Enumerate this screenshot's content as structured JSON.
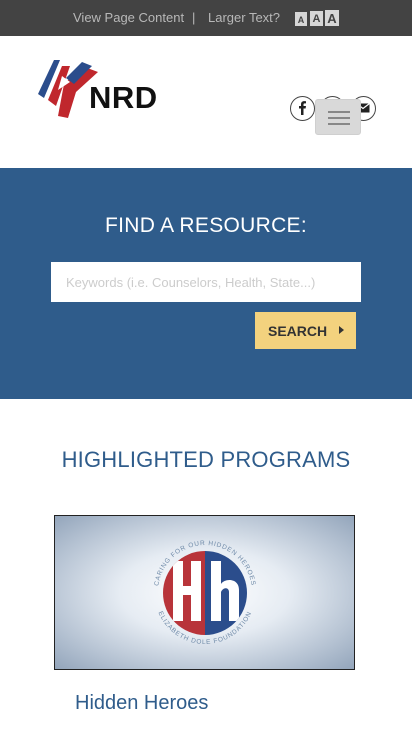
{
  "topbar": {
    "view_link": "View Page Content",
    "separator": "|",
    "larger_text_label": "Larger Text?",
    "size_small": "A",
    "size_medium": "A",
    "size_large": "A"
  },
  "header": {
    "logo_text": "NRD",
    "social": [
      "facebook-icon",
      "twitter-icon",
      "mail-icon"
    ],
    "menu_button": "hamburger-menu-icon"
  },
  "search": {
    "title": "FIND A RESOURCE:",
    "placeholder": "Keywords (i.e. Counselors, Health, State...)",
    "button_label": "SEARCH"
  },
  "programs": {
    "title": "HIGHLIGHTED PROGRAMS",
    "items": [
      {
        "name": "Hidden Heroes",
        "badge_top_text": "CARING FOR OUR HIDDEN HEROES",
        "badge_bottom_text": "ELIZABETH DOLE FOUNDATION",
        "badge_letters": "Hh"
      }
    ]
  },
  "colors": {
    "topbar": "#434343",
    "brand_blue": "#2f5c8b",
    "button_yellow": "#f3d27e",
    "logo_red": "#c0272d",
    "logo_blue": "#2b4d8c"
  }
}
